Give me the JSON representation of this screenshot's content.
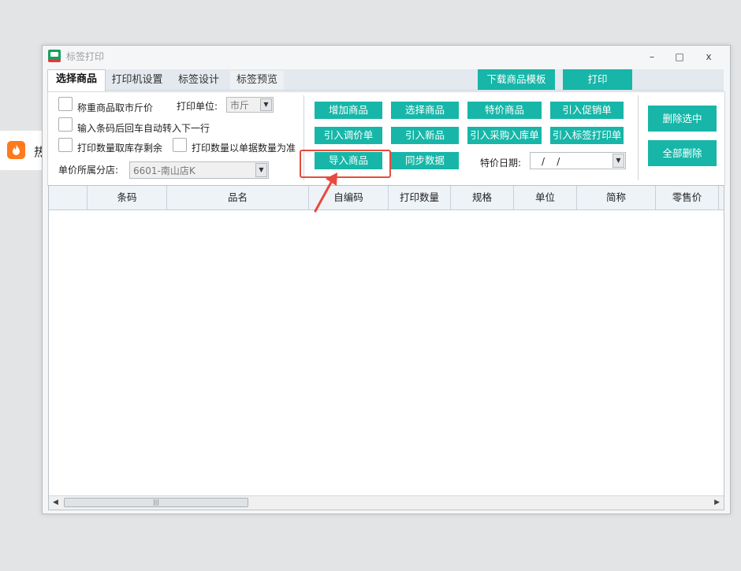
{
  "background": {
    "card_text": "热",
    "flame_icon": "flame-icon"
  },
  "window": {
    "title": "标签打印",
    "controls": {
      "minimize": "–",
      "maximize": "□",
      "close": "x"
    }
  },
  "tabs": [
    {
      "label": "选择商品",
      "active": true
    },
    {
      "label": "打印机设置"
    },
    {
      "label": "标签设计"
    },
    {
      "label": "标签预览"
    }
  ],
  "toolbar": {
    "download_template": "下载商品模板",
    "print": "打印"
  },
  "options": {
    "weigh_city_jin": "称重商品取市斤价",
    "print_unit_label": "打印单位:",
    "print_unit_value": "市斤",
    "auto_next_row": "输入条码后回车自动转入下一行",
    "qty_stock_remaining": "打印数量取库存剩余",
    "qty_by_document": "打印数量以单据数量为准",
    "branch_label": "单价所属分店:",
    "branch_value": "6601-南山店K"
  },
  "actions": {
    "add_product": "增加商品",
    "select_product": "选择商品",
    "special_product": "特价商品",
    "import_promo": "引入促销单",
    "import_price_adjust": "引入调价单",
    "import_new": "引入新品",
    "import_purchase": "引入采购入库单",
    "import_label_print": "引入标签打印单",
    "import_product": "导入商品",
    "sync_data": "同步数据",
    "special_date_label": "特价日期:",
    "special_date_value": "/    /",
    "delete_selected": "删除选中",
    "delete_all": "全部删除"
  },
  "grid": {
    "columns": [
      "条码",
      "品名",
      "自编码",
      "打印数量",
      "规格",
      "单位",
      "简称",
      "零售价"
    ],
    "rows": []
  },
  "colors": {
    "accent": "#17b6a8",
    "highlight": "#e64b3d"
  }
}
